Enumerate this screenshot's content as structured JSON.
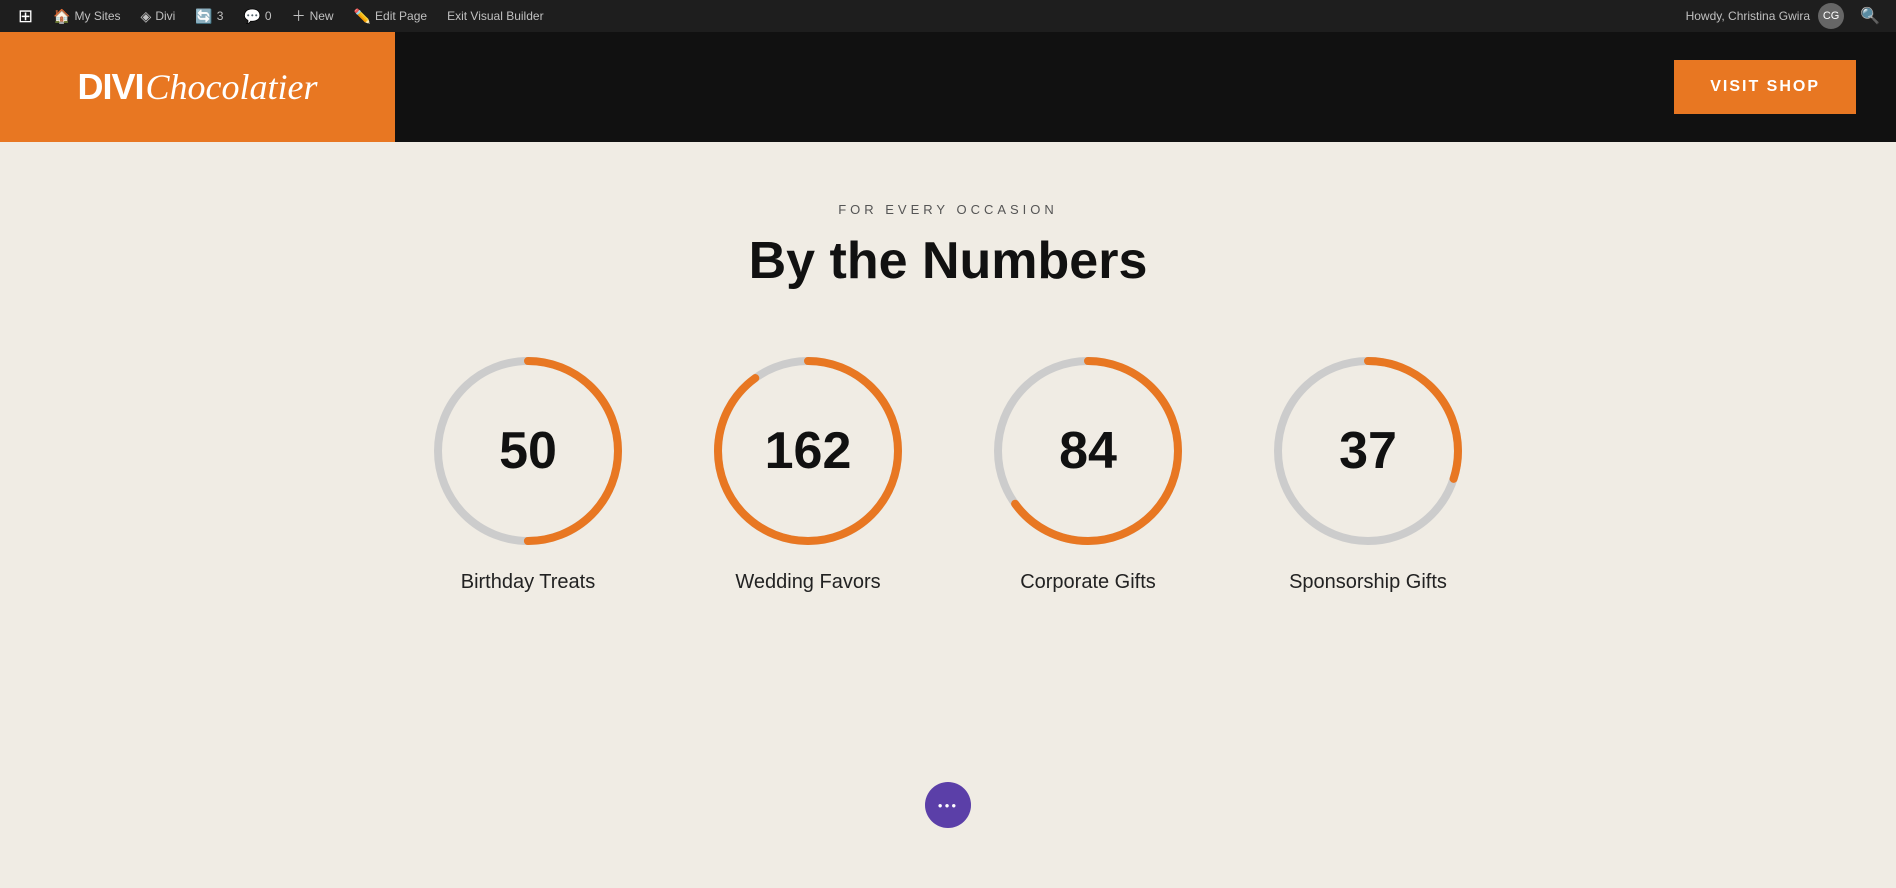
{
  "admin_bar": {
    "wordpress_icon": "⊞",
    "my_sites_label": "My Sites",
    "divi_label": "Divi",
    "updates_count": "3",
    "comments_count": "0",
    "new_label": "New",
    "edit_page_label": "Edit Page",
    "exit_visual_builder_label": "Exit Visual Builder",
    "howdy_text": "Howdy, Christina Gwira",
    "search_icon": "🔍"
  },
  "header": {
    "logo_divi": "DIVI",
    "logo_chocolatier": "Chocolatier",
    "visit_shop_label": "VISIT SHOP"
  },
  "section": {
    "subtitle": "FOR EVERY OCCASION",
    "title": "By the Numbers"
  },
  "stats": [
    {
      "value": "50",
      "label": "Birthday Treats",
      "percent": 50,
      "color": "#e87722",
      "track_color": "#ccc"
    },
    {
      "value": "162",
      "label": "Wedding Favors",
      "percent": 90,
      "color": "#e87722",
      "track_color": "#ccc"
    },
    {
      "value": "84",
      "label": "Corporate Gifts",
      "percent": 65,
      "color": "#e87722",
      "track_color": "#ccc"
    },
    {
      "value": "37",
      "label": "Sponsorship Gifts",
      "percent": 30,
      "color": "#e87722",
      "track_color": "#ccc"
    }
  ],
  "floating_btn": {
    "icon": "•••"
  }
}
